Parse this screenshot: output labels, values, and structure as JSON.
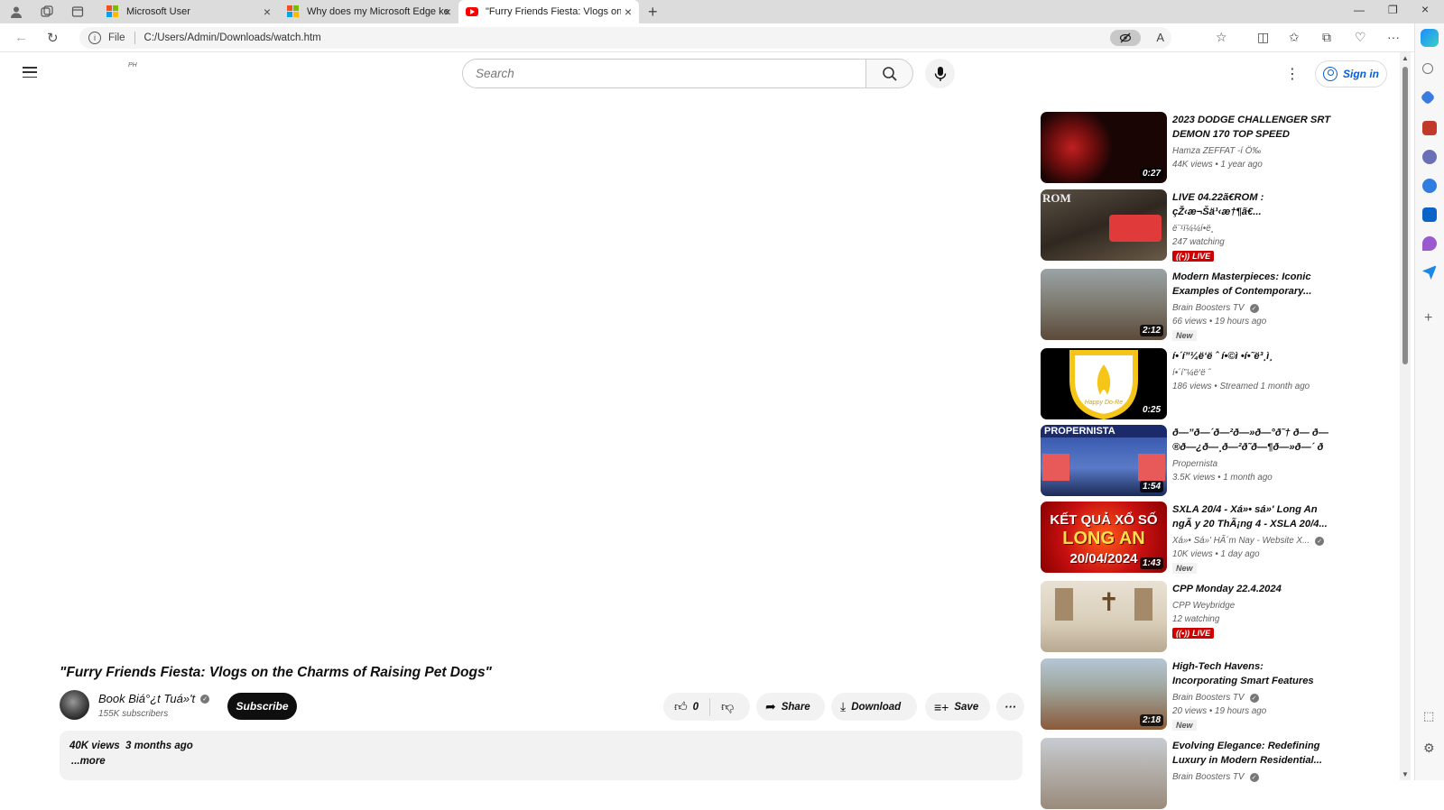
{
  "browser": {
    "tabs": [
      {
        "title": "Microsoft User",
        "icon": "microsoft-logo-icon",
        "active": false
      },
      {
        "title": "Why does my Microsoft Edge ke",
        "icon": "microsoft-logo-icon",
        "active": false
      },
      {
        "title": "\"Furry Friends Fiesta: Vlogs on th",
        "icon": "youtube-icon",
        "active": true
      }
    ],
    "address": {
      "scheme_label": "File",
      "url": "C:/Users/Admin/Downloads/watch.htm"
    }
  },
  "header": {
    "country_code": "PH",
    "search_placeholder": "Search",
    "signin_label": "Sign in"
  },
  "video": {
    "title": "\"Furry Friends Fiesta: Vlogs on the Charms of Raising Pet Dogs\"",
    "channel": "Book Biá°¿t Tuá»'t",
    "subscribers": "155K subscribers",
    "subscribe_label": "Subscribe",
    "likes": "0",
    "share_label": "Share",
    "download_label": "Download",
    "save_label": "Save",
    "views": "40K views",
    "age": "3 months ago",
    "more_label": "...more"
  },
  "recommendations": [
    {
      "title": "2023 DODGE CHALLENGER SRT DEMON 170 TOP SPEED",
      "channel": "Hamza ZEFFAT -í Ö‰",
      "meta1": "44K views",
      "meta2": "1 year ago",
      "duration": "0:27",
      "verified": false,
      "badge": ""
    },
    {
      "title": "LIVE 04.22ã€ROM : çŽ‹æ¬Šä¹‹æ†¶ã€...",
      "channel": "ë¨¹ï¼¼í•ë¸",
      "meta1": "247 watching",
      "meta2": "",
      "duration": "",
      "verified": false,
      "badge": "LIVE"
    },
    {
      "title": "Modern Masterpieces: Iconic Examples of Contemporary...",
      "channel": "Brain Boosters TV",
      "meta1": "66 views",
      "meta2": "19 hours ago",
      "duration": "2:12",
      "verified": true,
      "badge": "New"
    },
    {
      "title": "í•´í”¼ë‘ë ˆ í•©ì •í•˜ë³¸ì¸",
      "channel": "í•´í”¼ë‘ë ˆ",
      "meta1": "186 views",
      "meta2": "Streamed 1 month ago",
      "duration": "0:25",
      "verified": false,
      "badge": ""
    },
    {
      "title": "ð—”ð—´ð—²ð—»ð—°ð˜† ð— ð—®ð—¿ð—¸ð—²ð˜ð—¶ð—»ð—´ ð—¯ð—²ð˜€ð˜ ð—¶ð—»...",
      "channel": "Propernista",
      "meta1": "3.5K views",
      "meta2": "1 month ago",
      "duration": "1:54",
      "verified": false,
      "badge": ""
    },
    {
      "title": "SXLA 20/4 - Xá»• sá»' Long An ngÃ y 20 ThÃ¡ng 4 - XSLA 20/4...",
      "channel": "Xá»• Sá»' HÃ´m Nay - Website X...",
      "meta1": "10K views",
      "meta2": "1 day ago",
      "duration": "1:43",
      "verified": true,
      "badge": "New"
    },
    {
      "title": "CPP Monday 22.4.2024",
      "channel": "CPP Weybridge",
      "meta1": "12 watching",
      "meta2": "",
      "duration": "",
      "verified": false,
      "badge": "LIVE"
    },
    {
      "title": "High-Tech Havens: Incorporating Smart Features into Modern...",
      "channel": "Brain Boosters TV",
      "meta1": "20 views",
      "meta2": "19 hours ago",
      "duration": "2:18",
      "verified": true,
      "badge": "New"
    },
    {
      "title": "Evolving Elegance: Redefining Luxury in Modern Residential...",
      "channel": "Brain Boosters TV",
      "meta1": "",
      "meta2": "",
      "duration": "",
      "verified": true,
      "badge": ""
    }
  ],
  "colors": {
    "accent_blue": "#065fd4",
    "live_red": "#cc0000",
    "chip_bg": "#f2f2f2"
  }
}
